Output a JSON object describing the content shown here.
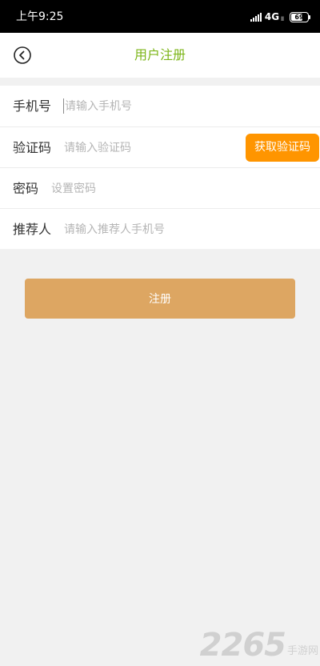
{
  "status_bar": {
    "time": "上午9:25",
    "network": "4G",
    "network_sub": "ll",
    "battery": "69",
    "battery_level": 0.69
  },
  "header": {
    "title": "用户注册",
    "back_icon": "back-circle-icon"
  },
  "form": {
    "phone": {
      "label": "手机号",
      "placeholder": "请输入手机号",
      "value": ""
    },
    "code": {
      "label": "验证码",
      "placeholder": "请输入验证码",
      "value": "",
      "button_label": "获取验证码"
    },
    "password": {
      "label": "密码",
      "placeholder": "设置密码",
      "value": ""
    },
    "referrer": {
      "label": "推荐人",
      "placeholder": "请输入推荐人手机号",
      "value": ""
    }
  },
  "register_button": {
    "label": "注册"
  },
  "watermark": {
    "number": "2265",
    "text": "手游网"
  },
  "colors": {
    "title": "#7cb518",
    "code_button": "#ff9500",
    "register_button": "#dda662",
    "background": "#f1f1f1"
  }
}
